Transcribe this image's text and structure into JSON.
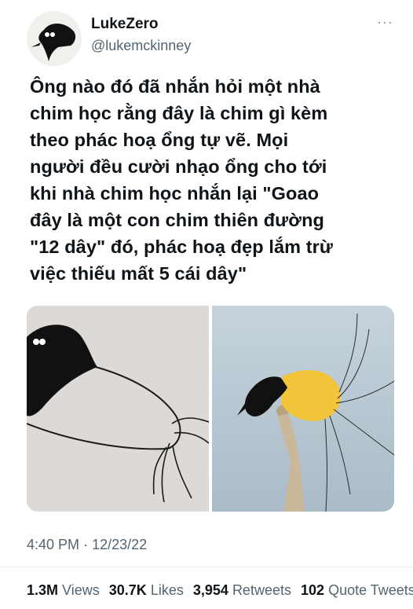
{
  "author": {
    "name": "LukeZero",
    "handle": "@lukemckinney",
    "more_label": "···"
  },
  "tweet": {
    "lines": [
      "Ông nào đó đã nhắn hỏi một nhà",
      "chim học rằng đây là chim gì kèm",
      "theo phác hoạ ổng tự vẽ. Mọi",
      "người đều cười nhạo ổng cho tới",
      "khi nhà chim học nhắn lại \"Goao",
      "đây là một con chim thiên đường",
      "\"12 dây\" đó, phác hoạ đẹp lắm trừ",
      "việc thiếu mất 5 cái dây\""
    ]
  },
  "media": {
    "images": [
      "bird-sketch-image",
      "twelve-wired-bird-of-paradise-photo"
    ]
  },
  "meta": {
    "time": "4:40 PM",
    "separator": "·",
    "date": "12/23/22"
  },
  "stats": {
    "views_count": "1.3M",
    "views_label": "Views",
    "likes_count": "30.7K",
    "likes_label": "Likes",
    "retweets_count": "3,954",
    "retweets_label": "Retweets",
    "quotes_count": "102",
    "quotes_label": "Quote Tweets"
  },
  "colors": {
    "text": "#0f1419",
    "secondary": "#536471",
    "bird_black": "#111111",
    "bird_yellow": "#f2c43a",
    "sky": "#b7c7d2",
    "paper": "#dcd9d6"
  }
}
